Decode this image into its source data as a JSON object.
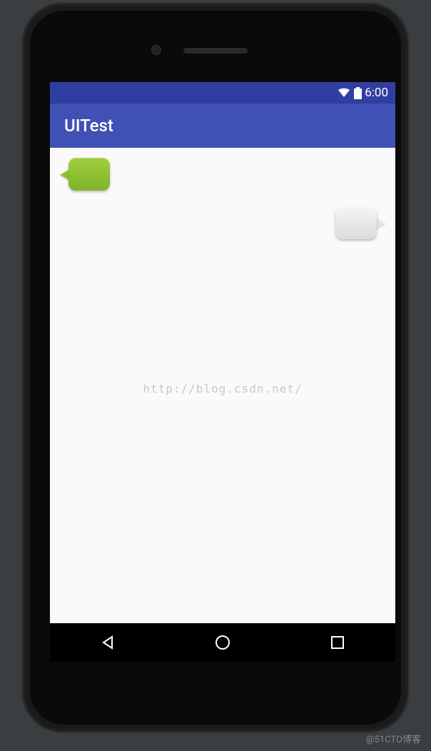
{
  "status_bar": {
    "time": "6:00"
  },
  "app_bar": {
    "title": "UITest"
  },
  "content": {
    "watermark_text": "http://blog.csdn.net/"
  },
  "footer": {
    "watermark": "@51CTO博客"
  }
}
